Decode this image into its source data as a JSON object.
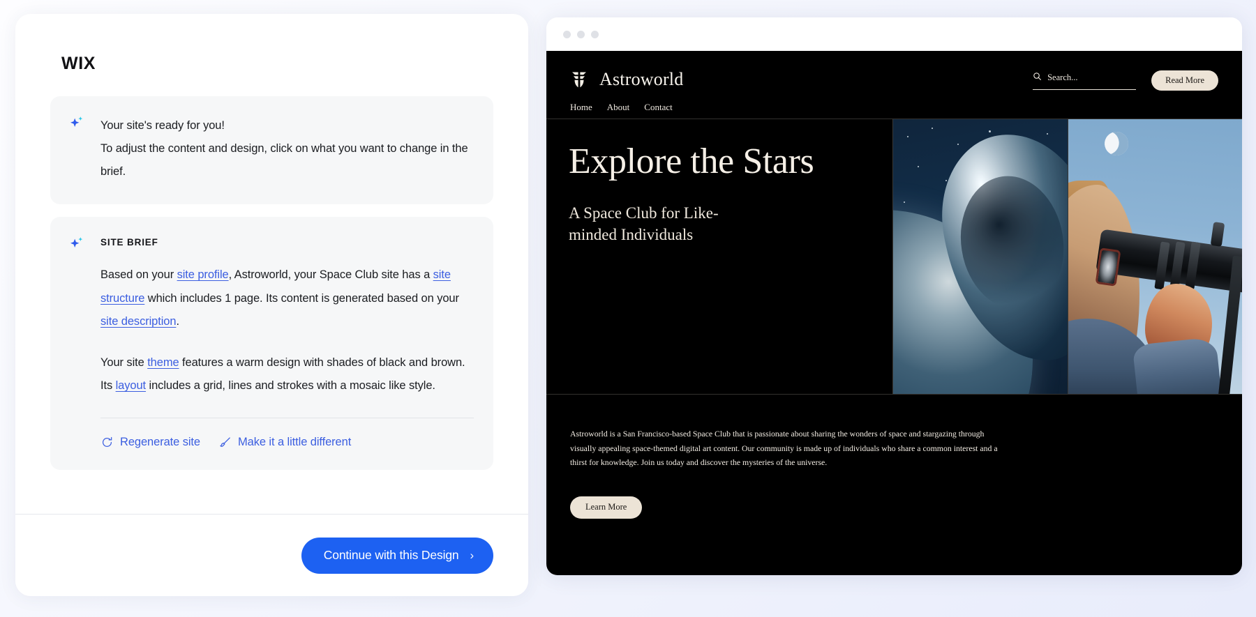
{
  "editor": {
    "brand": "WIX",
    "ready_card": {
      "icon": "sparkle-icon",
      "line1": "Your site's ready for you!",
      "line2": "To adjust the content and design, click on what you want to change in the brief."
    },
    "brief_card": {
      "icon": "sparkle-icon",
      "title": "SITE BRIEF",
      "paragraph1": {
        "p1": "Based on your ",
        "link1": "site profile",
        "p2": ", Astroworld, your Space Club site has a ",
        "link2": "site structure",
        "p3": " which includes 1 page. Its content is generated based on your ",
        "link3": "site description",
        "p4": "."
      },
      "paragraph2": {
        "p1": "Your site ",
        "link1": "theme",
        "p2": " features a warm design with shades of black and brown. Its ",
        "link2": "layout",
        "p3": " includes a grid, lines and strokes with a mosaic like style."
      },
      "actions": [
        {
          "label": "Regenerate site",
          "icon": "refresh-icon"
        },
        {
          "label": "Make it a little different",
          "icon": "brush-icon"
        }
      ]
    },
    "footer": {
      "cta_label": "Continue with this Design",
      "cta_chevron": "›",
      "cta_color": "#1d61f2"
    }
  },
  "preview": {
    "window_dots": 3,
    "site": {
      "brand": "Astroworld",
      "logo_icon": "stacked-bars-logo-icon",
      "nav": [
        "Home",
        "About",
        "Contact"
      ],
      "search": {
        "icon": "search-icon",
        "placeholder": "Search..."
      },
      "header_button": "Read More",
      "hero": {
        "title": "Explore the Stars",
        "subtitle": "A Space Club for Like-minded Individuals",
        "image1_alt": "asteroid-above-planet-image",
        "image2_alt": "person-with-telescope-image"
      },
      "about": {
        "text": "Astroworld is a San Francisco-based Space Club that is passionate about sharing the wonders of space and stargazing through visually appealing space-themed digital art content. Our community is made up of individuals who share a common interest and a thirst for knowledge. Join us today and discover the mysteries of the universe.",
        "button": "Learn More"
      },
      "colors": {
        "background": "#000000",
        "text": "#f4eee5",
        "accent_button": "#ece3d6"
      }
    }
  }
}
